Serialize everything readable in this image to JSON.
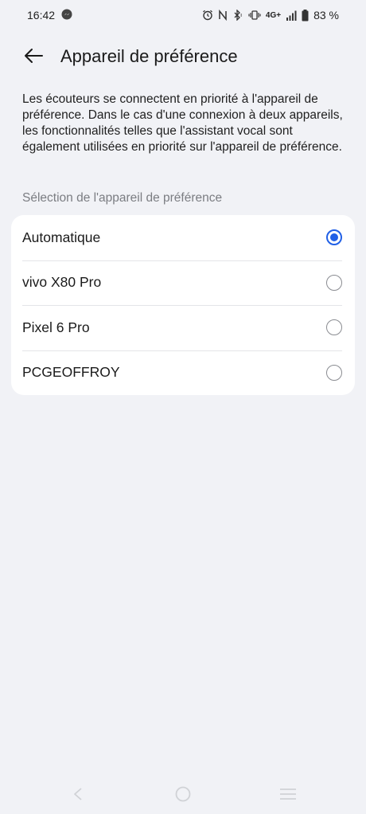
{
  "status_bar": {
    "time": "16:42",
    "network": "4G+",
    "battery": "83 %",
    "icons": [
      "messenger-icon",
      "alarm-icon",
      "nfc-icon",
      "bluetooth-icon",
      "vibrate-icon",
      "signal-icon",
      "battery-icon"
    ]
  },
  "header": {
    "title": "Appareil de préférence",
    "back_icon": "arrow-left-icon"
  },
  "description": "Les écouteurs se connectent en priorité à l'appareil de préférence. Dans le cas d'une connexion à deux appareils, les fonctionnalités telles que l'assistant vocal sont également utilisées en priorité sur l'appareil de préférence.",
  "section_label": "Sélection de l'appareil de préférence",
  "options": [
    {
      "label": "Automatique",
      "selected": true
    },
    {
      "label": "vivo X80 Pro",
      "selected": false
    },
    {
      "label": "Pixel 6 Pro",
      "selected": false
    },
    {
      "label": "PCGEOFFROY",
      "selected": false
    }
  ],
  "colors": {
    "accent": "#2160e6",
    "background": "#f1f2f6",
    "card": "#ffffff",
    "secondary_text": "#7b7d82"
  },
  "nav_bar": {
    "icons": [
      "nav-back-icon",
      "nav-home-icon",
      "nav-recents-icon"
    ]
  }
}
